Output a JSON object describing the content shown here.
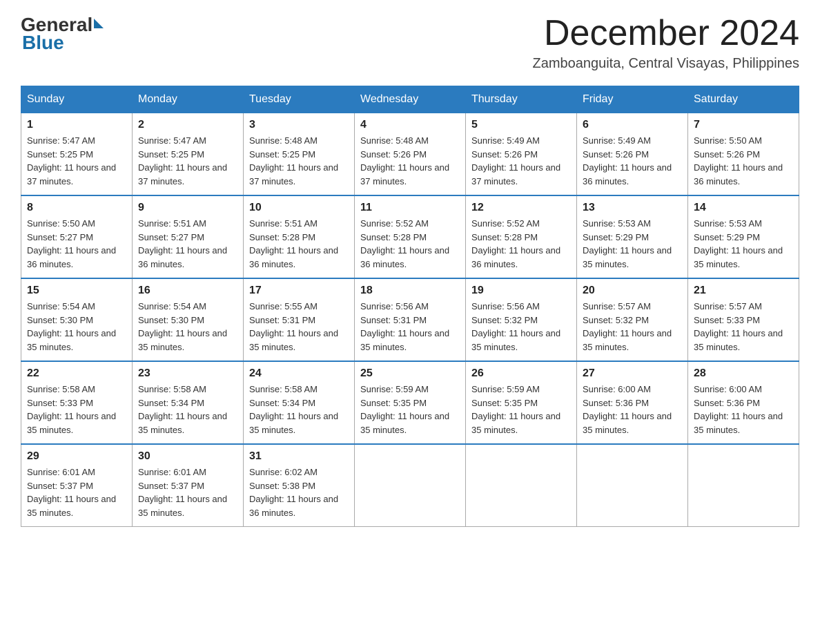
{
  "logo": {
    "general": "General",
    "blue": "Blue"
  },
  "title": "December 2024",
  "location": "Zamboanguita, Central Visayas, Philippines",
  "days_of_week": [
    "Sunday",
    "Monday",
    "Tuesday",
    "Wednesday",
    "Thursday",
    "Friday",
    "Saturday"
  ],
  "weeks": [
    [
      {
        "day": "1",
        "sunrise": "5:47 AM",
        "sunset": "5:25 PM",
        "daylight": "11 hours and 37 minutes."
      },
      {
        "day": "2",
        "sunrise": "5:47 AM",
        "sunset": "5:25 PM",
        "daylight": "11 hours and 37 minutes."
      },
      {
        "day": "3",
        "sunrise": "5:48 AM",
        "sunset": "5:25 PM",
        "daylight": "11 hours and 37 minutes."
      },
      {
        "day": "4",
        "sunrise": "5:48 AM",
        "sunset": "5:26 PM",
        "daylight": "11 hours and 37 minutes."
      },
      {
        "day": "5",
        "sunrise": "5:49 AM",
        "sunset": "5:26 PM",
        "daylight": "11 hours and 37 minutes."
      },
      {
        "day": "6",
        "sunrise": "5:49 AM",
        "sunset": "5:26 PM",
        "daylight": "11 hours and 36 minutes."
      },
      {
        "day": "7",
        "sunrise": "5:50 AM",
        "sunset": "5:26 PM",
        "daylight": "11 hours and 36 minutes."
      }
    ],
    [
      {
        "day": "8",
        "sunrise": "5:50 AM",
        "sunset": "5:27 PM",
        "daylight": "11 hours and 36 minutes."
      },
      {
        "day": "9",
        "sunrise": "5:51 AM",
        "sunset": "5:27 PM",
        "daylight": "11 hours and 36 minutes."
      },
      {
        "day": "10",
        "sunrise": "5:51 AM",
        "sunset": "5:28 PM",
        "daylight": "11 hours and 36 minutes."
      },
      {
        "day": "11",
        "sunrise": "5:52 AM",
        "sunset": "5:28 PM",
        "daylight": "11 hours and 36 minutes."
      },
      {
        "day": "12",
        "sunrise": "5:52 AM",
        "sunset": "5:28 PM",
        "daylight": "11 hours and 36 minutes."
      },
      {
        "day": "13",
        "sunrise": "5:53 AM",
        "sunset": "5:29 PM",
        "daylight": "11 hours and 35 minutes."
      },
      {
        "day": "14",
        "sunrise": "5:53 AM",
        "sunset": "5:29 PM",
        "daylight": "11 hours and 35 minutes."
      }
    ],
    [
      {
        "day": "15",
        "sunrise": "5:54 AM",
        "sunset": "5:30 PM",
        "daylight": "11 hours and 35 minutes."
      },
      {
        "day": "16",
        "sunrise": "5:54 AM",
        "sunset": "5:30 PM",
        "daylight": "11 hours and 35 minutes."
      },
      {
        "day": "17",
        "sunrise": "5:55 AM",
        "sunset": "5:31 PM",
        "daylight": "11 hours and 35 minutes."
      },
      {
        "day": "18",
        "sunrise": "5:56 AM",
        "sunset": "5:31 PM",
        "daylight": "11 hours and 35 minutes."
      },
      {
        "day": "19",
        "sunrise": "5:56 AM",
        "sunset": "5:32 PM",
        "daylight": "11 hours and 35 minutes."
      },
      {
        "day": "20",
        "sunrise": "5:57 AM",
        "sunset": "5:32 PM",
        "daylight": "11 hours and 35 minutes."
      },
      {
        "day": "21",
        "sunrise": "5:57 AM",
        "sunset": "5:33 PM",
        "daylight": "11 hours and 35 minutes."
      }
    ],
    [
      {
        "day": "22",
        "sunrise": "5:58 AM",
        "sunset": "5:33 PM",
        "daylight": "11 hours and 35 minutes."
      },
      {
        "day": "23",
        "sunrise": "5:58 AM",
        "sunset": "5:34 PM",
        "daylight": "11 hours and 35 minutes."
      },
      {
        "day": "24",
        "sunrise": "5:58 AM",
        "sunset": "5:34 PM",
        "daylight": "11 hours and 35 minutes."
      },
      {
        "day": "25",
        "sunrise": "5:59 AM",
        "sunset": "5:35 PM",
        "daylight": "11 hours and 35 minutes."
      },
      {
        "day": "26",
        "sunrise": "5:59 AM",
        "sunset": "5:35 PM",
        "daylight": "11 hours and 35 minutes."
      },
      {
        "day": "27",
        "sunrise": "6:00 AM",
        "sunset": "5:36 PM",
        "daylight": "11 hours and 35 minutes."
      },
      {
        "day": "28",
        "sunrise": "6:00 AM",
        "sunset": "5:36 PM",
        "daylight": "11 hours and 35 minutes."
      }
    ],
    [
      {
        "day": "29",
        "sunrise": "6:01 AM",
        "sunset": "5:37 PM",
        "daylight": "11 hours and 35 minutes."
      },
      {
        "day": "30",
        "sunrise": "6:01 AM",
        "sunset": "5:37 PM",
        "daylight": "11 hours and 35 minutes."
      },
      {
        "day": "31",
        "sunrise": "6:02 AM",
        "sunset": "5:38 PM",
        "daylight": "11 hours and 36 minutes."
      },
      null,
      null,
      null,
      null
    ]
  ]
}
